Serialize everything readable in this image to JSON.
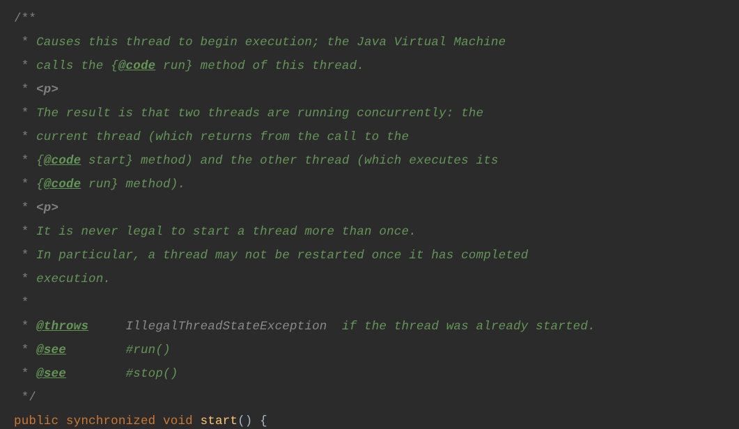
{
  "javadoc": {
    "open": "/**",
    "star": " * ",
    "star_only": " *",
    "close": " */",
    "line1_a": "Causes this thread to begin execution; the Java Virtual Machine",
    "line2_a": "calls the ",
    "line2_brace_open": "{",
    "line2_tag": "@code",
    "line2_code": " run",
    "line2_brace_close": "}",
    "line2_b": " method of this thread.",
    "ptag": "<p>",
    "line4_a": "The result is that two threads are running concurrently: the",
    "line5_a": "current thread (which returns from the call to the",
    "line6_brace_open": "{",
    "line6_tag": "@code",
    "line6_code": " start",
    "line6_brace_close": "}",
    "line6_b": " method) and the other thread (which executes its",
    "line7_brace_open": "{",
    "line7_tag": "@code",
    "line7_code": " run",
    "line7_brace_close": "}",
    "line7_b": " method).",
    "line9_a": "It is never legal to start a thread more than once.",
    "line10_a": "In particular, a thread may not be restarted once it has completed",
    "line11_a": "execution.",
    "throws_tag": "@throws",
    "throws_pad": "     ",
    "throws_cls": "IllegalThreadStateException  ",
    "throws_txt": "if the thread was already started.",
    "see_tag": "@see",
    "see_pad": "        ",
    "see1": "#run()",
    "see2": "#stop()"
  },
  "decl": {
    "kw_public": "public",
    "sp1": " ",
    "kw_sync": "synchronized",
    "sp2": " ",
    "kw_void": "void",
    "sp3": " ",
    "method": "start",
    "parens_brace": "() {"
  }
}
